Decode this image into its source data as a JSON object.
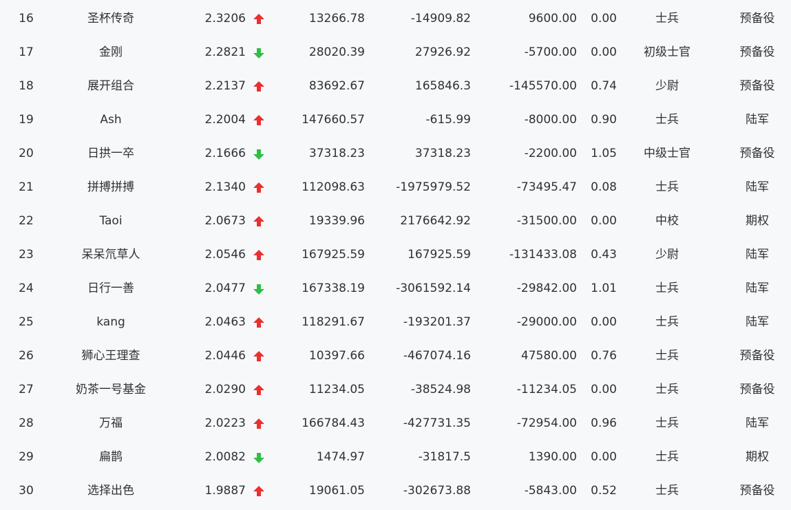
{
  "colors": {
    "up": "#e8312f",
    "down": "#2fbf44",
    "text": "#303133",
    "background": "#f7f8fa"
  },
  "rows": [
    {
      "rank": "16",
      "name": "圣杯传奇",
      "score": "2.3206",
      "trend": "up",
      "v1": "13266.78",
      "v2": "-14909.82",
      "v3": "9600.00",
      "v4": "0.00",
      "title": "士兵",
      "category": "预备役"
    },
    {
      "rank": "17",
      "name": "金刚",
      "score": "2.2821",
      "trend": "down",
      "v1": "28020.39",
      "v2": "27926.92",
      "v3": "-5700.00",
      "v4": "0.00",
      "title": "初级士官",
      "category": "预备役"
    },
    {
      "rank": "18",
      "name": "展开组合",
      "score": "2.2137",
      "trend": "up",
      "v1": "83692.67",
      "v2": "165846.3",
      "v3": "-145570.00",
      "v4": "0.74",
      "title": "少尉",
      "category": "预备役"
    },
    {
      "rank": "19",
      "name": "Ash",
      "score": "2.2004",
      "trend": "up",
      "v1": "147660.57",
      "v2": "-615.99",
      "v3": "-8000.00",
      "v4": "0.90",
      "title": "士兵",
      "category": "陆军"
    },
    {
      "rank": "20",
      "name": "日拱一卒",
      "score": "2.1666",
      "trend": "down",
      "v1": "37318.23",
      "v2": "37318.23",
      "v3": "-2200.00",
      "v4": "1.05",
      "title": "中级士官",
      "category": "预备役"
    },
    {
      "rank": "21",
      "name": "拼搏拼搏",
      "score": "2.1340",
      "trend": "up",
      "v1": "112098.63",
      "v2": "-1975979.52",
      "v3": "-73495.47",
      "v4": "0.08",
      "title": "士兵",
      "category": "陆军"
    },
    {
      "rank": "22",
      "name": "Taoi",
      "score": "2.0673",
      "trend": "up",
      "v1": "19339.96",
      "v2": "2176642.92",
      "v3": "-31500.00",
      "v4": "0.00",
      "title": "中校",
      "category": "期权"
    },
    {
      "rank": "23",
      "name": "呆呆氘草人",
      "score": "2.0546",
      "trend": "up",
      "v1": "167925.59",
      "v2": "167925.59",
      "v3": "-131433.08",
      "v4": "0.43",
      "title": "少尉",
      "category": "陆军"
    },
    {
      "rank": "24",
      "name": "日行一善",
      "score": "2.0477",
      "trend": "down",
      "v1": "167338.19",
      "v2": "-3061592.14",
      "v3": "-29842.00",
      "v4": "1.01",
      "title": "士兵",
      "category": "陆军"
    },
    {
      "rank": "25",
      "name": "kang",
      "score": "2.0463",
      "trend": "up",
      "v1": "118291.67",
      "v2": "-193201.37",
      "v3": "-29000.00",
      "v4": "0.00",
      "title": "士兵",
      "category": "陆军"
    },
    {
      "rank": "26",
      "name": "狮心王理查",
      "score": "2.0446",
      "trend": "up",
      "v1": "10397.66",
      "v2": "-467074.16",
      "v3": "47580.00",
      "v4": "0.76",
      "title": "士兵",
      "category": "预备役"
    },
    {
      "rank": "27",
      "name": "奶茶一号基金",
      "score": "2.0290",
      "trend": "up",
      "v1": "11234.05",
      "v2": "-38524.98",
      "v3": "-11234.05",
      "v4": "0.00",
      "title": "士兵",
      "category": "预备役"
    },
    {
      "rank": "28",
      "name": "万福",
      "score": "2.0223",
      "trend": "up",
      "v1": "166784.43",
      "v2": "-427731.35",
      "v3": "-72954.00",
      "v4": "0.96",
      "title": "士兵",
      "category": "陆军"
    },
    {
      "rank": "29",
      "name": "扁鹊",
      "score": "2.0082",
      "trend": "down",
      "v1": "1474.97",
      "v2": "-31817.5",
      "v3": "1390.00",
      "v4": "0.00",
      "title": "士兵",
      "category": "期权"
    },
    {
      "rank": "30",
      "name": "选择出色",
      "score": "1.9887",
      "trend": "up",
      "v1": "19061.05",
      "v2": "-302673.88",
      "v3": "-5843.00",
      "v4": "0.52",
      "title": "士兵",
      "category": "预备役"
    }
  ]
}
